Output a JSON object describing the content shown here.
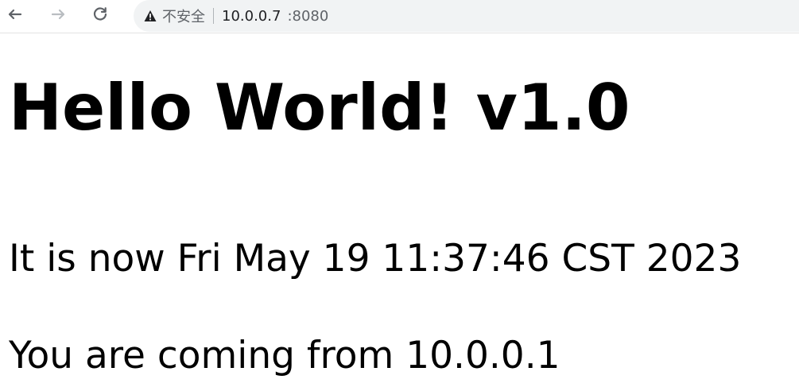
{
  "browser": {
    "security_label": "不安全",
    "url_host": "10.0.0.7",
    "url_port": ":8080",
    "icons": {
      "back": "back-arrow-icon",
      "forward": "forward-arrow-icon",
      "reload": "reload-icon",
      "warning": "warning-icon"
    },
    "colors": {
      "omnibox_bg": "#f1f3f4",
      "icon_dark": "#5f6368",
      "icon_disabled": "#b9bdc1"
    }
  },
  "page": {
    "heading": "Hello World! v1.0",
    "time_line": "It is now Fri May 19 11:37:46 CST 2023",
    "source_line": "You are coming from 10.0.0.1"
  }
}
